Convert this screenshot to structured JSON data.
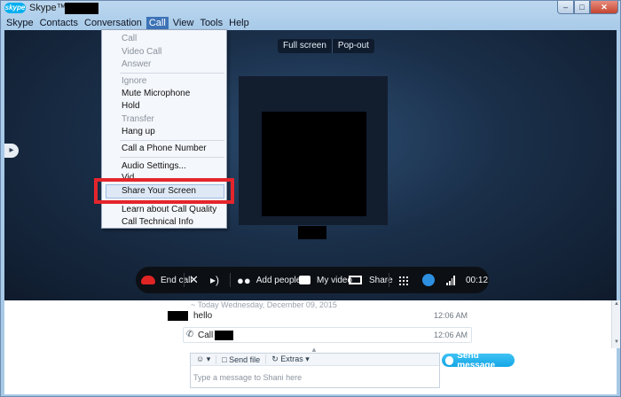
{
  "window": {
    "logo_text": "skype",
    "title": "Skype™ -",
    "minimize": "–",
    "maximize": "□",
    "close": "✕"
  },
  "menubar": {
    "items": [
      "Skype",
      "Contacts",
      "Conversation",
      "Call",
      "View",
      "Tools",
      "Help"
    ],
    "active": "Call"
  },
  "stage": {
    "full_screen": "Full screen",
    "pop_out": "Pop-out",
    "callbar": {
      "end_call": "End call",
      "add_people": "Add people",
      "my_video": "My video",
      "share": "Share",
      "timer": "00:12"
    }
  },
  "call_menu": {
    "call": "Call",
    "video_call": "Video Call",
    "answer": "Answer",
    "ignore": "Ignore",
    "mute_microphone": "Mute Microphone",
    "hold": "Hold",
    "transfer": "Transfer",
    "hang_up": "Hang up",
    "call_phone_number": "Call a Phone Number",
    "audio_settings": "Audio Settings...",
    "video_settings_partial": "Vid",
    "share_screen": "Share Your Screen",
    "learn_call_quality": "Learn about Call Quality",
    "call_technical_info": "Call Technical Info"
  },
  "conversation": {
    "date_line": "~ Today Wednesday, December 09, 2015",
    "messages": [
      {
        "text": "hello",
        "time": "12:06 AM"
      },
      {
        "text": "Call to",
        "time": "12:06 AM"
      }
    ],
    "composer": {
      "emoticon": "☺ ▾",
      "send_file": "Send file",
      "extras": "Extras ▾",
      "placeholder": "Type a message to Shani here"
    },
    "send_button": "Send message"
  },
  "colors": {
    "menu_active": "#3d73b7",
    "end_call_red": "#e02424",
    "highlight_red": "#e4252b",
    "send_blue": "#14a6e6"
  }
}
